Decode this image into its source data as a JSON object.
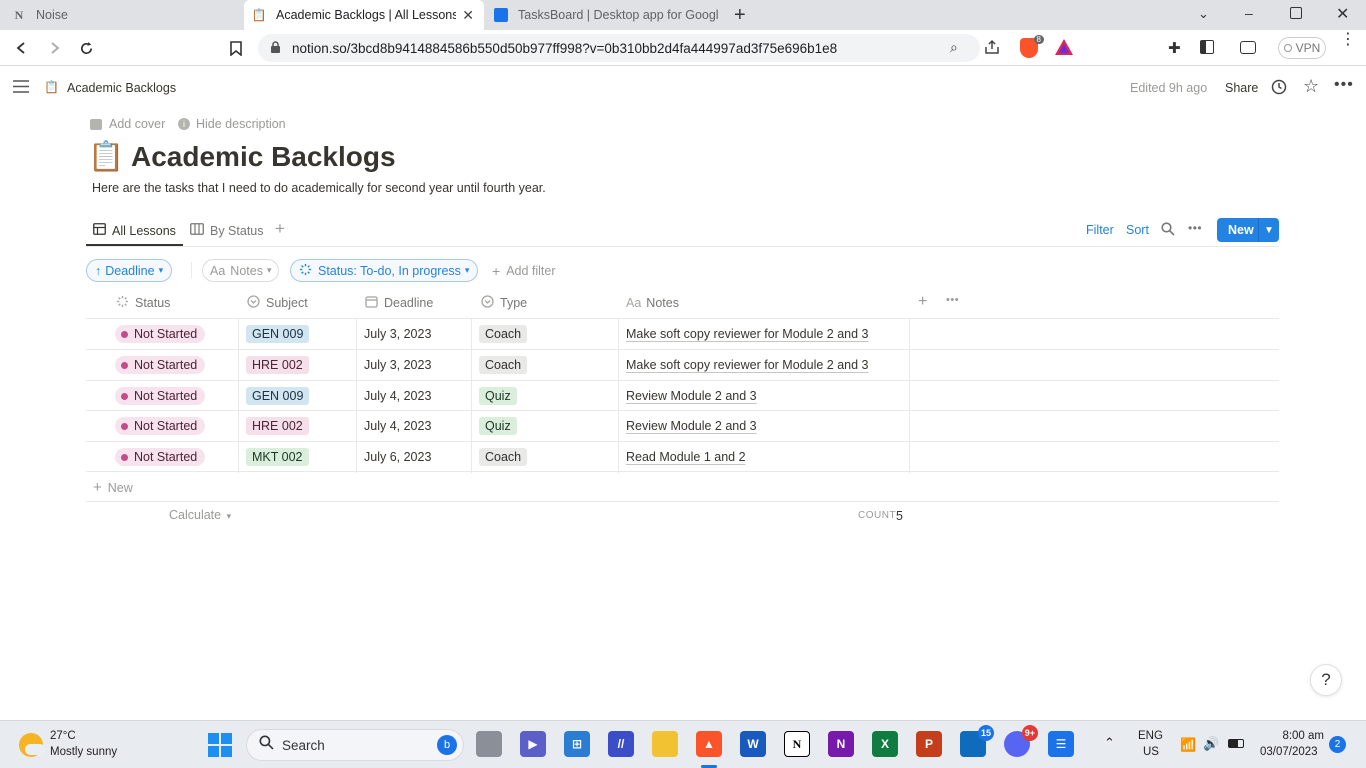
{
  "browser": {
    "tabs": [
      {
        "title": "Noise",
        "icon": "notion-logo"
      },
      {
        "title": "Academic Backlogs | All Lessons",
        "icon": "clipboard-icon"
      },
      {
        "title": "TasksBoard | Desktop app for Google T",
        "icon": "tasksboard-logo"
      }
    ],
    "url": "notion.so/3bcd8b9414884586b550d50b977ff998?v=0b310bb2d4fa444997ad3f75e696b1e8",
    "vpn_label": "VPN",
    "brave_badge": "8"
  },
  "page": {
    "breadcrumb": "Academic Backlogs",
    "edited": "Edited 9h ago",
    "share": "Share",
    "add_cover": "Add cover",
    "hide_description": "Hide description",
    "title_emoji": "📋",
    "title": "Academic Backlogs",
    "description": "Here are the tasks that I need to do academically for second year until fourth year."
  },
  "views": {
    "tabs": [
      "All Lessons",
      "By Status"
    ],
    "filter": "Filter",
    "sort": "Sort",
    "new_button": "New"
  },
  "filters": {
    "deadline": "Deadline",
    "notes": "Notes",
    "notes_prefix": "Aa",
    "status": "Status: To-do, In progress",
    "add_filter": "Add filter"
  },
  "table": {
    "columns": [
      "Status",
      "Subject",
      "Deadline",
      "Type",
      "Notes"
    ],
    "notes_prefix": "Aa",
    "rows": [
      {
        "status": "Not Started",
        "subject": "GEN 009",
        "deadline": "July 3, 2023",
        "type": "Coach",
        "notes": "Make soft copy reviewer for Module 2 and 3"
      },
      {
        "status": "Not Started",
        "subject": "HRE 002",
        "deadline": "July 3, 2023",
        "type": "Coach",
        "notes": "Make soft copy reviewer for Module 2 and 3"
      },
      {
        "status": "Not Started",
        "subject": "GEN 009",
        "deadline": "July 4, 2023",
        "type": "Quiz",
        "notes": "Review Module 2 and 3"
      },
      {
        "status": "Not Started",
        "subject": "HRE 002",
        "deadline": "July 4, 2023",
        "type": "Quiz",
        "notes": "Review Module 2 and 3"
      },
      {
        "status": "Not Started",
        "subject": "MKT 002",
        "deadline": "July 6, 2023",
        "type": "Coach",
        "notes": "Read Module 1 and 2"
      }
    ],
    "new_row": "New",
    "calculate": "Calculate",
    "count_label": "COUNT",
    "count_value": "5"
  },
  "colors": {
    "accent": "#2383e2",
    "status_pill_bg": "#f7e3ee",
    "gen_bg": "#d3e5ef",
    "hre_bg": "#f5e0e9",
    "mkt_bg": "#dbeddb",
    "quiz_bg": "#dbeddb",
    "coach_bg": "#e9e9e7"
  },
  "help": "?",
  "taskbar": {
    "weather_temp": "27°C",
    "weather_desc": "Mostly sunny",
    "search": "Search",
    "lang_top": "ENG",
    "lang_bottom": "US",
    "time": "8:00 am",
    "date": "03/07/2023",
    "notif_count": "2",
    "outlook_badge": "15",
    "discord_badge": "9+"
  }
}
